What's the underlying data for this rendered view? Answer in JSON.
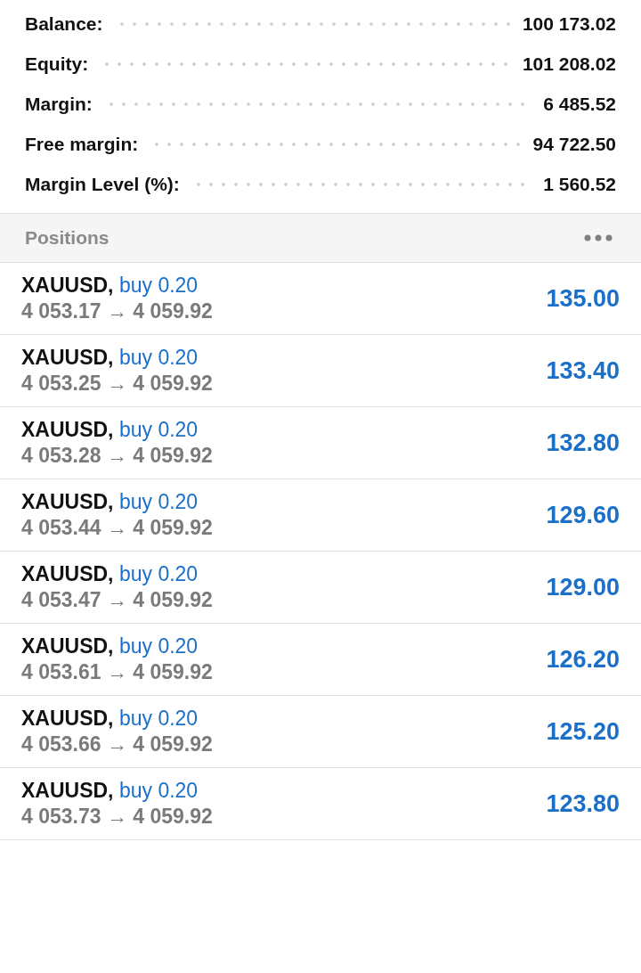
{
  "summary": [
    {
      "label": "Balance:",
      "value": "100 173.02"
    },
    {
      "label": "Equity:",
      "value": "101 208.02"
    },
    {
      "label": "Margin:",
      "value": "6 485.52"
    },
    {
      "label": "Free margin:",
      "value": "94 722.50"
    },
    {
      "label": "Margin Level (%):",
      "value": "1 560.52"
    }
  ],
  "positions_header": {
    "title": "Positions"
  },
  "positions": [
    {
      "symbol": "XAUUSD,",
      "side": "buy 0.20",
      "prices": "4 053.17 → 4 059.92",
      "profit": "135.00"
    },
    {
      "symbol": "XAUUSD,",
      "side": "buy 0.20",
      "prices": "4 053.25 → 4 059.92",
      "profit": "133.40"
    },
    {
      "symbol": "XAUUSD,",
      "side": "buy 0.20",
      "prices": "4 053.28 → 4 059.92",
      "profit": "132.80"
    },
    {
      "symbol": "XAUUSD,",
      "side": "buy 0.20",
      "prices": "4 053.44 → 4 059.92",
      "profit": "129.60"
    },
    {
      "symbol": "XAUUSD,",
      "side": "buy 0.20",
      "prices": "4 053.47 → 4 059.92",
      "profit": "129.00"
    },
    {
      "symbol": "XAUUSD,",
      "side": "buy 0.20",
      "prices": "4 053.61 → 4 059.92",
      "profit": "126.20"
    },
    {
      "symbol": "XAUUSD,",
      "side": "buy 0.20",
      "prices": "4 053.66 → 4 059.92",
      "profit": "125.20"
    },
    {
      "symbol": "XAUUSD,",
      "side": "buy 0.20",
      "prices": "4 053.73 → 4 059.92",
      "profit": "123.80"
    }
  ]
}
